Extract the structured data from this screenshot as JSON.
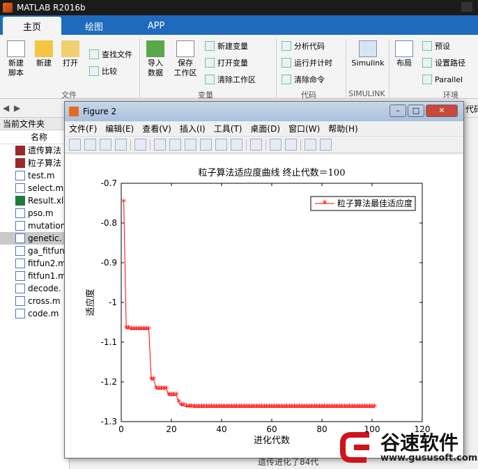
{
  "app": {
    "title": "MATLAB R2016b"
  },
  "tabs": [
    {
      "label": "主页"
    },
    {
      "label": "绘图"
    },
    {
      "label": "APP"
    }
  ],
  "ribbon": {
    "new_script": "新建\n脚本",
    "new": "新建",
    "open": "打开",
    "find_files": "查找文件",
    "compare": "比较",
    "import_data": "导入\n数据",
    "save_workspace": "保存\n工作区",
    "new_variable": "新建变量",
    "open_variable": "打开变量",
    "clear_workspace": "清除工作区",
    "analyze_code": "分析代码",
    "run_and_time": "运行并计时",
    "clear_commands": "清除命令",
    "simulink": "Simulink",
    "layout": "布局",
    "preferences": "预设",
    "set_path": "设置路径",
    "parallel": "Parallel",
    "group_file": "文件",
    "group_variable": "变量",
    "group_code": "代码",
    "group_simulink": "SIMULINK",
    "group_env": "环境"
  },
  "left_panel": {
    "title": "当前文件夹",
    "column": "名称",
    "files": [
      {
        "name": "遗传算法",
        "type": "png"
      },
      {
        "name": "粒子算法",
        "type": "png"
      },
      {
        "name": "test.m",
        "type": "m"
      },
      {
        "name": "select.m",
        "type": "m"
      },
      {
        "name": "Result.xls",
        "type": "xls"
      },
      {
        "name": "pso.m",
        "type": "m"
      },
      {
        "name": "mutation",
        "type": "m"
      },
      {
        "name": "genetic.",
        "type": "m",
        "selected": true
      },
      {
        "name": "ga_fitfun",
        "type": "m"
      },
      {
        "name": "fitfun2.m",
        "type": "m"
      },
      {
        "name": "fitfun1.m",
        "type": "m"
      },
      {
        "name": "decode.",
        "type": "m"
      },
      {
        "name": "cross.m",
        "type": "m"
      },
      {
        "name": "code.m",
        "type": "m"
      }
    ]
  },
  "addr": {
    "fragment": "代码"
  },
  "figure": {
    "title": "Figure 2",
    "menus": [
      "文件(F)",
      "编辑(E)",
      "查看(V)",
      "插入(I)",
      "工具(T)",
      "桌面(D)",
      "窗口(W)",
      "帮助(H)"
    ]
  },
  "chart_data": {
    "type": "line",
    "title": "粒子算法适应度曲线  终止代数＝100",
    "xlabel": "进化代数",
    "ylabel": "适应度",
    "xlim": [
      0,
      120
    ],
    "ylim": [
      -1.3,
      -0.7
    ],
    "xticks": [
      "0",
      "20",
      "40",
      "60",
      "80",
      "100",
      "120"
    ],
    "yticks": [
      "-0.7",
      "-0.8",
      "-0.9",
      "-1",
      "-1.1",
      "-1.2",
      "-1.3"
    ],
    "grid": false,
    "legend": "top-right",
    "series": [
      {
        "name": "粒子算法最佳适应度",
        "color": "#ff0000",
        "marker": "*",
        "x": [
          1,
          2,
          3,
          4,
          5,
          6,
          7,
          8,
          9,
          10,
          11,
          12,
          13,
          14,
          15,
          16,
          17,
          18,
          19,
          20,
          21,
          22,
          23,
          24,
          25,
          26,
          27,
          28,
          29,
          30,
          31,
          32,
          33,
          34,
          35,
          36,
          37,
          38,
          39,
          40,
          41,
          42,
          43,
          44,
          45,
          46,
          47,
          48,
          49,
          50,
          51,
          52,
          53,
          54,
          55,
          56,
          57,
          58,
          59,
          60,
          61,
          62,
          63,
          64,
          65,
          66,
          67,
          68,
          69,
          70,
          71,
          72,
          73,
          74,
          75,
          76,
          77,
          78,
          79,
          80,
          81,
          82,
          83,
          84,
          85,
          86,
          87,
          88,
          89,
          90,
          91,
          92,
          93,
          94,
          95,
          96,
          97,
          98,
          99,
          100,
          101
        ],
        "y": [
          -0.748,
          -1.066,
          -1.066,
          -1.068,
          -1.068,
          -1.068,
          -1.068,
          -1.068,
          -1.068,
          -1.068,
          -1.068,
          -1.195,
          -1.195,
          -1.218,
          -1.218,
          -1.218,
          -1.218,
          -1.218,
          -1.234,
          -1.234,
          -1.234,
          -1.234,
          -1.252,
          -1.26,
          -1.26,
          -1.263,
          -1.263,
          -1.263,
          -1.264,
          -1.264,
          -1.264,
          -1.264,
          -1.264,
          -1.264,
          -1.264,
          -1.264,
          -1.264,
          -1.264,
          -1.264,
          -1.264,
          -1.264,
          -1.264,
          -1.264,
          -1.264,
          -1.264,
          -1.264,
          -1.264,
          -1.264,
          -1.264,
          -1.264,
          -1.264,
          -1.264,
          -1.264,
          -1.264,
          -1.264,
          -1.264,
          -1.264,
          -1.264,
          -1.264,
          -1.264,
          -1.264,
          -1.264,
          -1.264,
          -1.264,
          -1.264,
          -1.264,
          -1.264,
          -1.264,
          -1.264,
          -1.264,
          -1.264,
          -1.264,
          -1.264,
          -1.264,
          -1.264,
          -1.264,
          -1.264,
          -1.264,
          -1.264,
          -1.264,
          -1.264,
          -1.264,
          -1.264,
          -1.264,
          -1.264,
          -1.264,
          -1.264,
          -1.264,
          -1.264,
          -1.264,
          -1.264,
          -1.264,
          -1.264,
          -1.264,
          -1.264,
          -1.264,
          -1.264,
          -1.264,
          -1.264,
          -1.264,
          -1.264
        ]
      }
    ]
  },
  "log_text": "遗传进化了84代",
  "watermark": {
    "name": "谷速软件",
    "url": "www.gususoft.com"
  }
}
